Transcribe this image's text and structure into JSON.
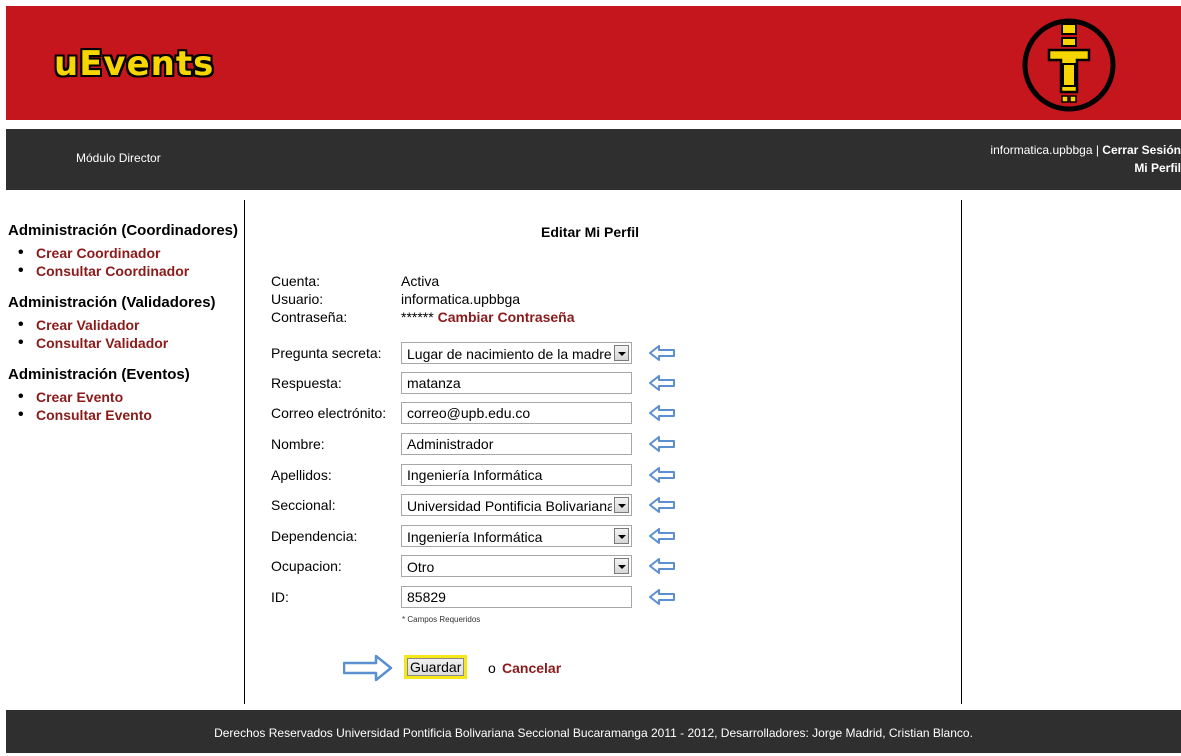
{
  "header": {
    "logo_text": "uEvents"
  },
  "navbar": {
    "module": "Módulo Director",
    "username": "informatica.upbbga",
    "separator": " | ",
    "logout": "Cerrar Sesión",
    "profile": "Mi Perfil"
  },
  "sidebar": [
    {
      "title": "Administración (Coordinadores)",
      "items": [
        "Crear Coordinador",
        "Consultar Coordinador"
      ]
    },
    {
      "title": "Administración (Validadores)",
      "items": [
        "Crear Validador",
        "Consultar Validador"
      ]
    },
    {
      "title": "Administración (Eventos)",
      "items": [
        "Crear Evento",
        "Consultar Evento"
      ]
    }
  ],
  "form": {
    "title": "Editar Mi Perfil",
    "account_label": "Cuenta:",
    "account_value": "Activa",
    "user_label": "Usuario:",
    "user_value": "informatica.upbbga",
    "password_label": "Contraseña:",
    "password_value": "******",
    "change_password": "Cambiar Contraseña",
    "question_label": "Pregunta secreta:",
    "question_value": "Lugar de nacimiento de la madre",
    "answer_label": "Respuesta:",
    "answer_value": "matanza",
    "email_label": "Correo electrónito:",
    "email_value": "correo@upb.edu.co",
    "name_label": "Nombre:",
    "name_value": "Administrador",
    "lastname_label": "Apellidos:",
    "lastname_value": "Ingeniería Informática",
    "branch_label": "Seccional:",
    "branch_value": "Universidad Pontificia Bolivariana",
    "dependency_label": "Dependencia:",
    "dependency_value": "Ingeniería Informática",
    "occupation_label": "Ocupacion:",
    "occupation_value": "Otro",
    "id_label": "ID:",
    "id_value": "85829",
    "required_note": "* Campos Requeridos",
    "save": "Guardar",
    "or": "o",
    "cancel": "Cancelar"
  },
  "footer": {
    "text": "Derechos Reservados Universidad Pontificia Bolivariana Seccional Bucaramanga 2011 - 2012, Desarrolladores: Jorge Madrid, Cristian Blanco."
  },
  "colors": {
    "header": "#c4161c",
    "nav": "#2f2f2f",
    "link": "#8b1a1a",
    "logo": "#f6d500",
    "arrow": "#5b8fd0"
  }
}
